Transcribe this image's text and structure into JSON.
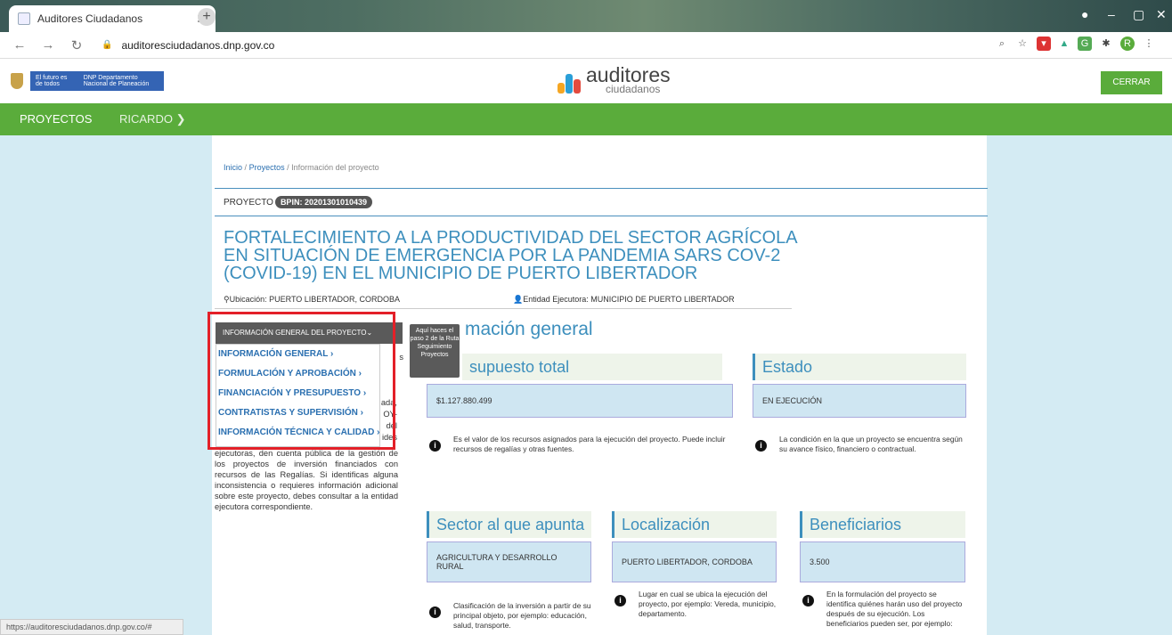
{
  "browser": {
    "tab_title": "Auditores Ciudadanos",
    "url": "auditoresciudadanos.dnp.gov.co",
    "status_url": "https://auditoresciudadanos.dnp.gov.co/#"
  },
  "header": {
    "gov_badge_left": "El futuro es de todos",
    "gov_badge_right": "DNP Departamento Nacional de Planeación",
    "logo_main": "auditores",
    "logo_sub": "ciudadanos",
    "logout_label": "CERRAR SESIÓN"
  },
  "menu": {
    "projects": "PROYECTOS",
    "user": "RICARDO"
  },
  "breadcrumb": {
    "home": "Inicio",
    "projects": "Proyectos",
    "current": "Información del proyecto",
    "sep": "/"
  },
  "project": {
    "label": "PROYECTO",
    "bpin": "BPIN: 20201301010439",
    "title": "FORTALECIMIENTO A LA PRODUCTIVIDAD DEL SECTOR AGRÍCOLA EN SITUACIÓN DE EMERGENCIA POR LA PANDEMIA SARS COV-2 (COVID-19) EN EL MUNICIPIO DE PUERTO LIBERTADOR",
    "location": "Ubicación: PUERTO LIBERTADOR, CORDOBA",
    "entity": "Entidad Ejecutora: MUNICIPIO DE PUERTO LIBERTADOR"
  },
  "dropdown": {
    "button": "INFORMACIÓN GENERAL DEL PROYECTO",
    "items": [
      "INFORMACIÓN GENERAL",
      "FORMULACIÓN Y APROBACIÓN",
      "FINANCIACIÓN Y PRESUPUESTO",
      "CONTRATISTAS Y SUPERVISIÓN",
      "INFORMACIÓN TÉCNICA Y CALIDAD"
    ],
    "tooltip": "Aquí haces el paso 2 de la Ruta Seguimiento Proyectos"
  },
  "left_text": {
    "fragments": [
      "s",
      "ada,",
      "OY-",
      "del",
      "ides"
    ],
    "body": "ejecutoras, den cuenta pública de la gestión de los proyectos de inversión financiados con recursos de las Regalías. Si identificas alguna inconsistencia o requieres información adicional sobre este proyecto, debes consultar a la entidad ejecutora correspondiente."
  },
  "main": {
    "heading": "mación general",
    "presupuesto": {
      "title": "supuesto total",
      "value": "$1.127.880.499",
      "note": "Es el valor de los recursos asignados para la ejecución del proyecto. Puede incluir recursos de regalías y otras fuentes."
    },
    "estado": {
      "title": "Estado",
      "value": "EN EJECUCIÓN",
      "note": "La condición en la que un proyecto se encuentra según su avance físico, financiero o contractual."
    },
    "sector": {
      "title": "Sector al que apunta",
      "value": "AGRICULTURA Y DESARROLLO RURAL",
      "note": "Clasificación de la inversión a partir de su principal objeto, por ejemplo: educación, salud, transporte."
    },
    "localizacion": {
      "title": "Localización",
      "value": "PUERTO LIBERTADOR, CORDOBA",
      "note": "Lugar en cual se ubica la ejecución del proyecto, por ejemplo: Vereda, municipio, departamento."
    },
    "beneficiarios": {
      "title": "Beneficiarios",
      "value": "3.500",
      "note": "En la formulación del proyecto se identifica quiénes harán uso del proyecto después de su ejecución. Los beneficiarios pueden ser, por ejemplo:"
    }
  },
  "colors": {
    "green": "#5aac3b",
    "blue": "#3d8fbd",
    "highlight": "#e32028"
  }
}
